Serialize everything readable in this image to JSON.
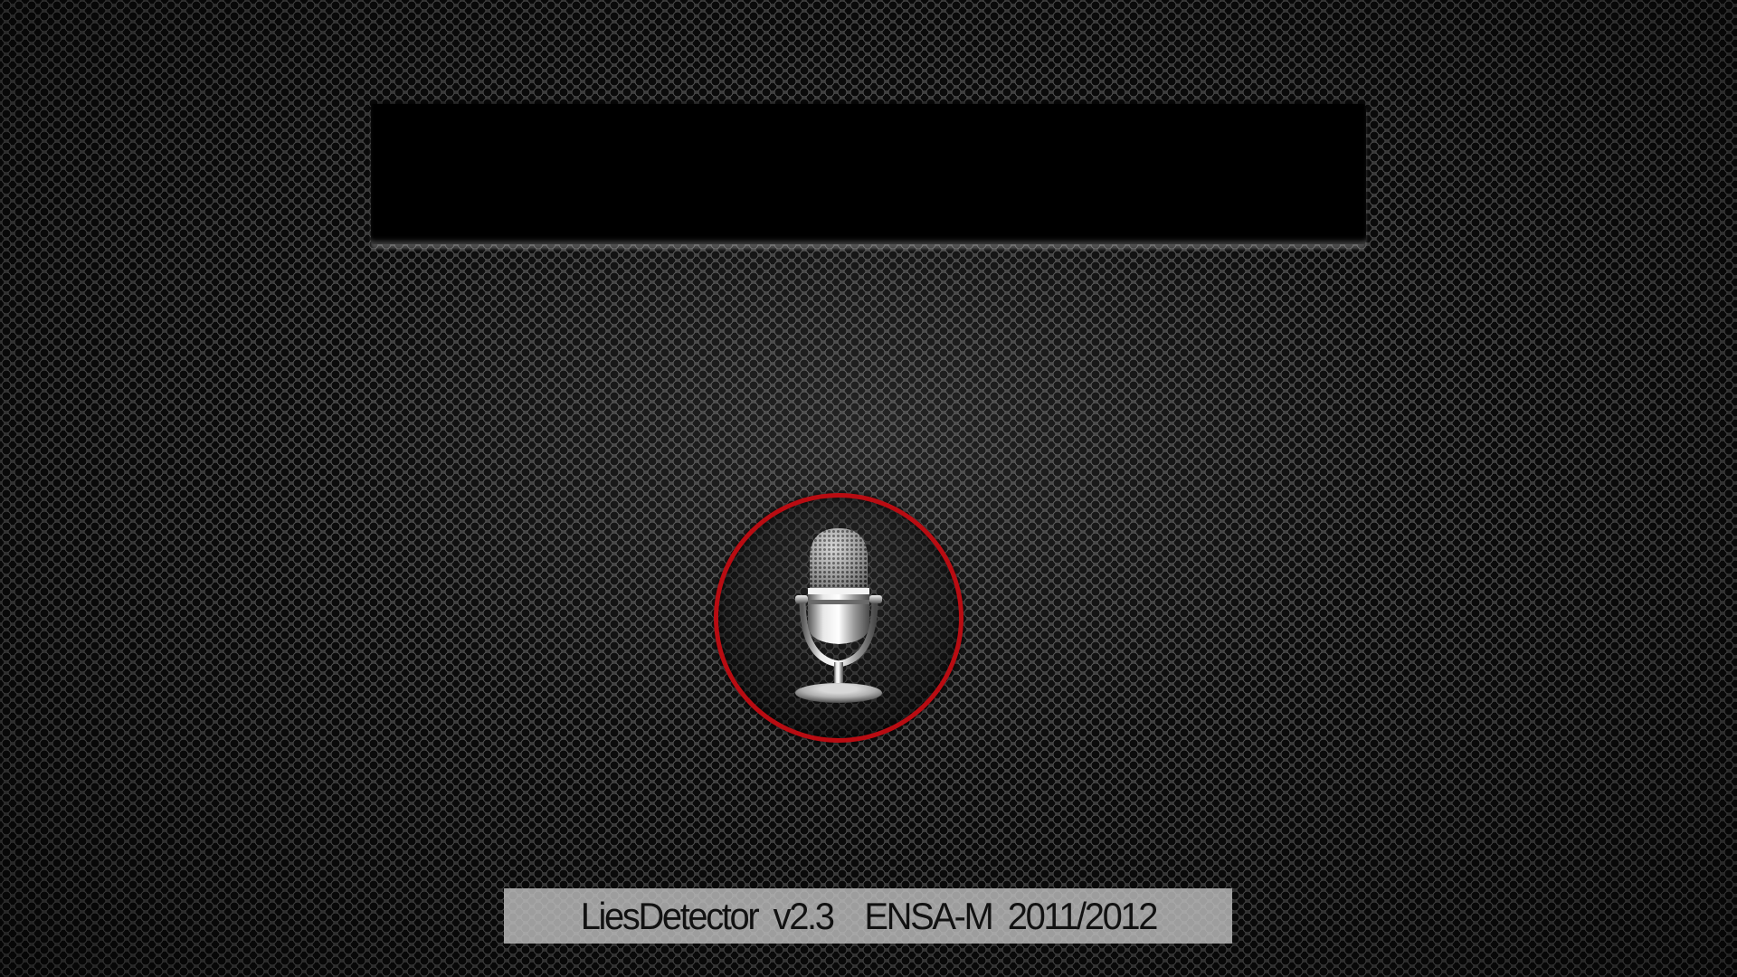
{
  "display": {
    "text": ""
  },
  "mic_button": {
    "icon": "microphone-icon",
    "ring_color": "#b90c12"
  },
  "footer": {
    "label": "LiesDetector  v2.3    ENSA-M  2011/2012"
  }
}
